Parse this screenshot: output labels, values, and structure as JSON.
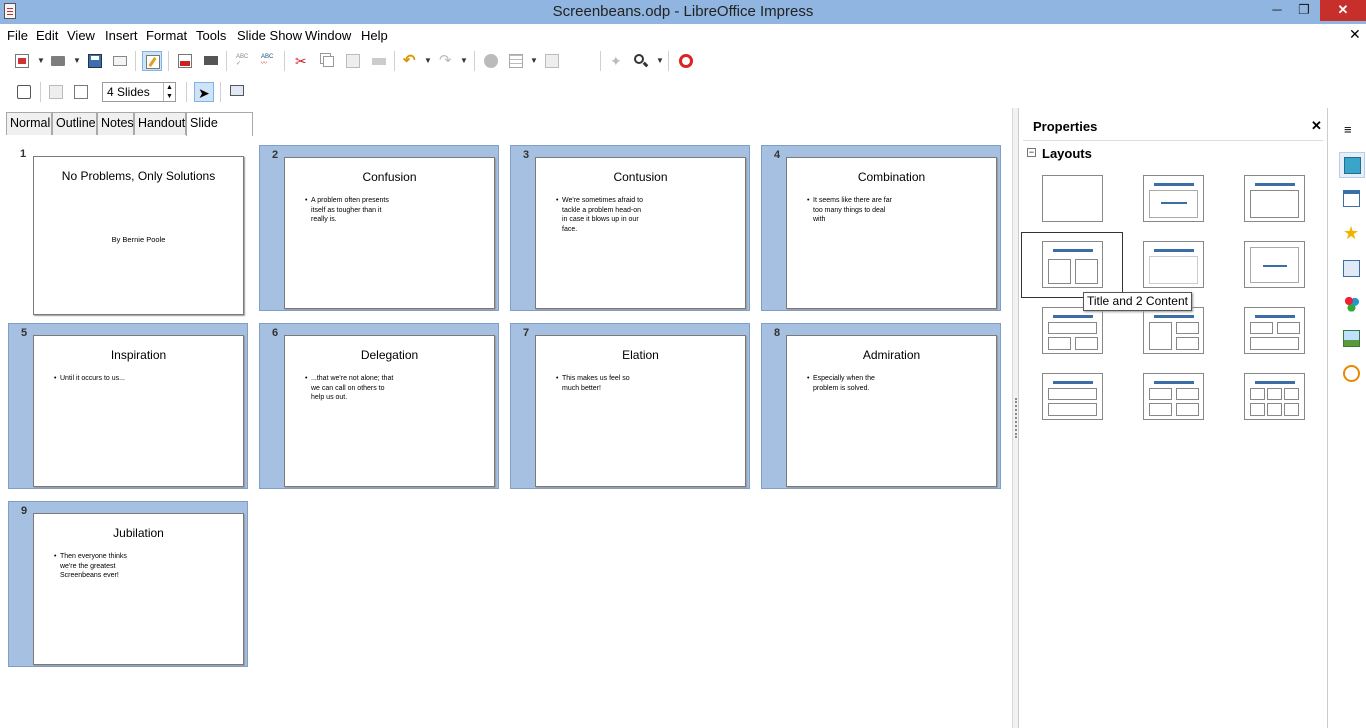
{
  "window": {
    "title": "Screenbeans.odp - LibreOffice Impress",
    "minimize": "─",
    "maximize": "❐",
    "close": "✕"
  },
  "menu": [
    "File",
    "Edit",
    "View",
    "Insert",
    "Format",
    "Tools",
    "Slide Show",
    "Window",
    "Help"
  ],
  "doc_close": "✕",
  "toolbar2": {
    "slides_per_row": "4 Slides"
  },
  "tabs": [
    "Normal",
    "Outline",
    "Notes",
    "Handout",
    "Slide Sorter"
  ],
  "active_tab": "Slide Sorter",
  "slides": [
    {
      "num": "1",
      "title": "No Problems, Only Solutions",
      "subtitle": "By Bernie Poole"
    },
    {
      "num": "2",
      "title": "Confusion",
      "body": "A problem often presents itself as tougher than it really is."
    },
    {
      "num": "3",
      "title": "Contusion",
      "body": "We're sometimes afraid to tackle a problem head-on in case it blows up in our face."
    },
    {
      "num": "4",
      "title": "Combination",
      "body": "It seems like there are far too many things to deal with"
    },
    {
      "num": "5",
      "title": "Inspiration",
      "body": "Until it occurs to us..."
    },
    {
      "num": "6",
      "title": "Delegation",
      "body": "...that we're not alone; that we can call on others to help us out."
    },
    {
      "num": "7",
      "title": "Elation",
      "body": "This makes us feel so much better!"
    },
    {
      "num": "8",
      "title": "Admiration",
      "body": "Especially when the problem is solved."
    },
    {
      "num": "9",
      "title": "Jubilation",
      "body": "Then everyone thinks we're the greatest Screenbeans ever!"
    }
  ],
  "sidebar": {
    "title": "Properties",
    "close": "✕",
    "section": "Layouts",
    "toggle": "−",
    "menu": "≡",
    "tooltip": "Title and 2 Content"
  }
}
